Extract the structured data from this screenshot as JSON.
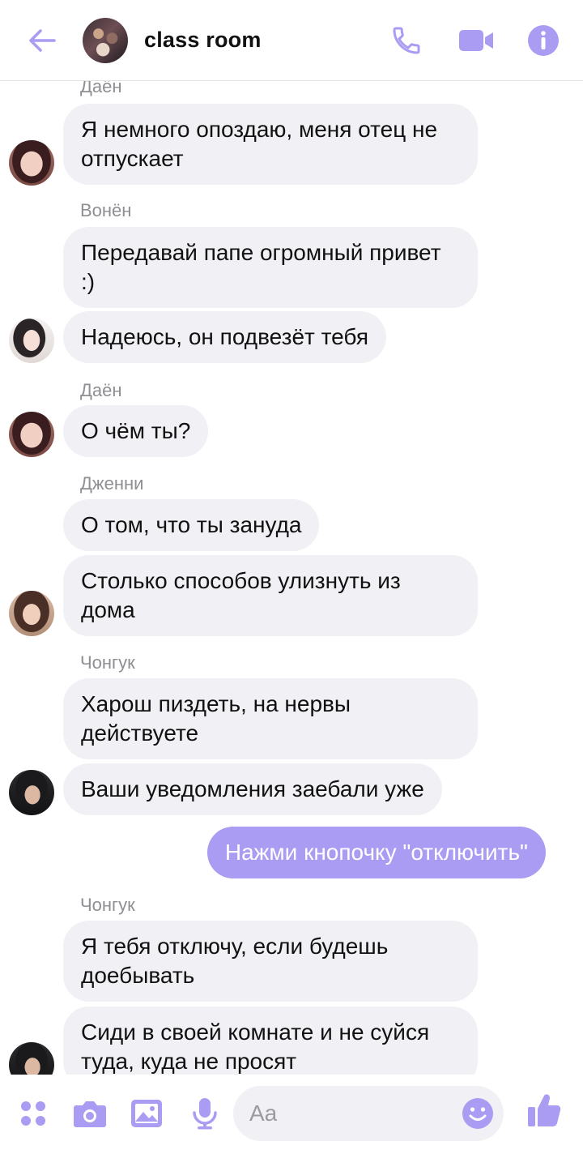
{
  "header": {
    "title": "class room",
    "icons": [
      "back-arrow-icon",
      "phone-icon",
      "video-camera-icon",
      "info-icon"
    ]
  },
  "colors": {
    "accent": "#a99cf2",
    "bubble_in": "#f1f0f4",
    "sender": "#8e8e93"
  },
  "messages": [
    {
      "sender": "Даён"
    },
    {
      "text": "Я немного опоздаю, меня отец не отпускает"
    },
    {
      "sender": "Вонён"
    },
    {
      "text": "Передавай папе огромный привет :)"
    },
    {
      "text": "Надеюсь, он подвезёт тебя"
    },
    {
      "sender": "Даён"
    },
    {
      "text": "О чём ты?"
    },
    {
      "sender": "Дженни"
    },
    {
      "text": "О том, что ты зануда"
    },
    {
      "text": "Столько способов улизнуть из дома"
    },
    {
      "sender": "Чонгук"
    },
    {
      "text": "Харош пиздеть, на нервы действуете"
    },
    {
      "text": "Ваши уведомления заебали уже"
    },
    {
      "text": "Нажми кнопочку \"отключить\""
    },
    {
      "sender": "Чонгук"
    },
    {
      "text": "Я тебя отключу, если будешь доебывать"
    },
    {
      "text": "Сиди в своей комнате и не суйся туда, куда не просят"
    }
  ],
  "composer": {
    "placeholder": "Aa",
    "icons": [
      "apps-icon",
      "camera-icon",
      "gallery-icon",
      "microphone-icon",
      "emoji-icon",
      "thumbs-up-icon"
    ]
  }
}
